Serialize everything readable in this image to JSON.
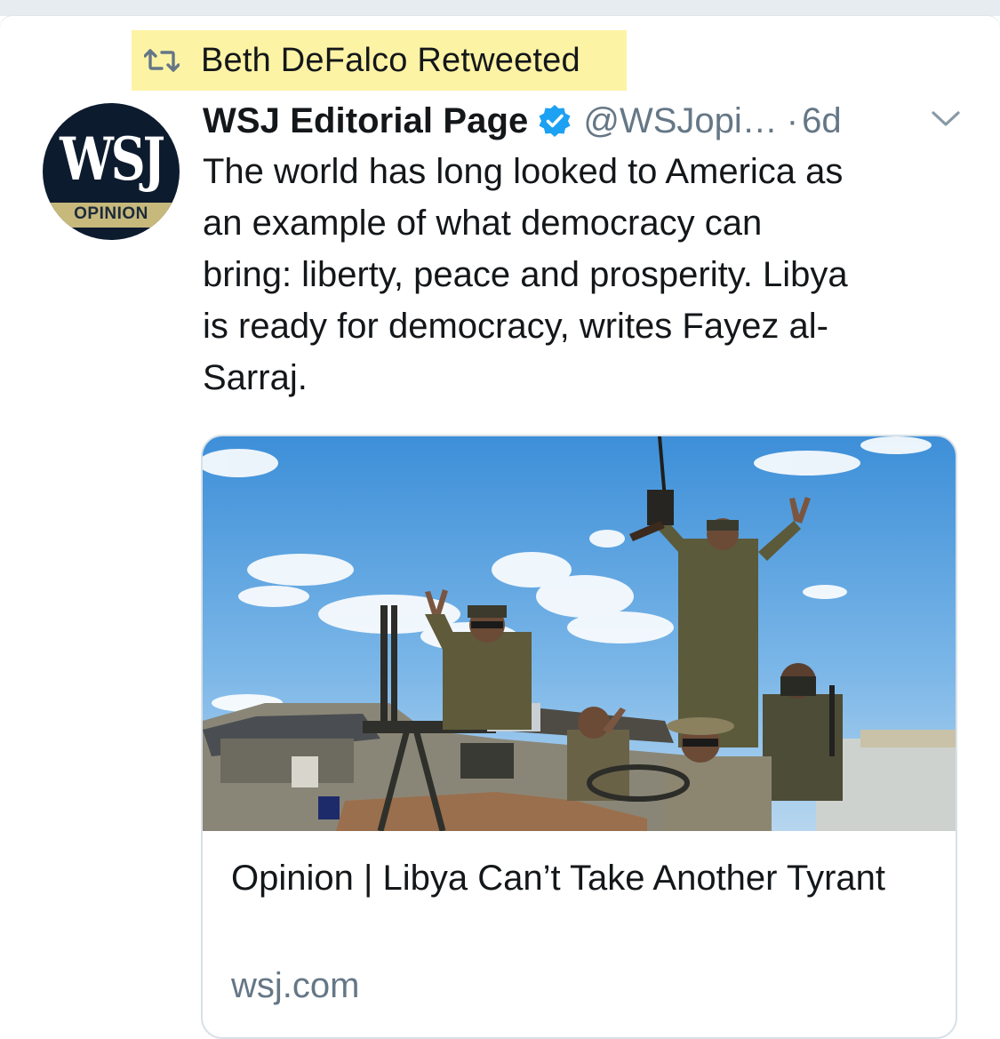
{
  "retweet": {
    "icon": "retweet-icon",
    "text": "Beth DeFalco Retweeted",
    "highlight_color": "#fdf3a5"
  },
  "tweet": {
    "avatar": {
      "logo_text": "WSJ",
      "band_text": "OPINION"
    },
    "author_name": "WSJ Editorial Page",
    "verified_icon": "verified-badge-icon",
    "handle": "@WSJopi…",
    "separator": "·",
    "time": "6d",
    "menu_icon": "chevron-down-icon",
    "text": "The world has long looked to America as\nan example of what democracy can\nbring: liberty, peace and prosperity. Libya\nis ready for democracy, writes Fayez al-\nSarraj."
  },
  "link_card": {
    "image": "soldiers-on-truck-photo",
    "title": "Opinion | Libya Can’t Take Another Tyrant",
    "domain": "wsj.com"
  },
  "colors": {
    "text_primary": "#14171a",
    "text_secondary": "#657786",
    "verified_blue": "#1da1f2",
    "card_border": "#d9e1e7"
  }
}
